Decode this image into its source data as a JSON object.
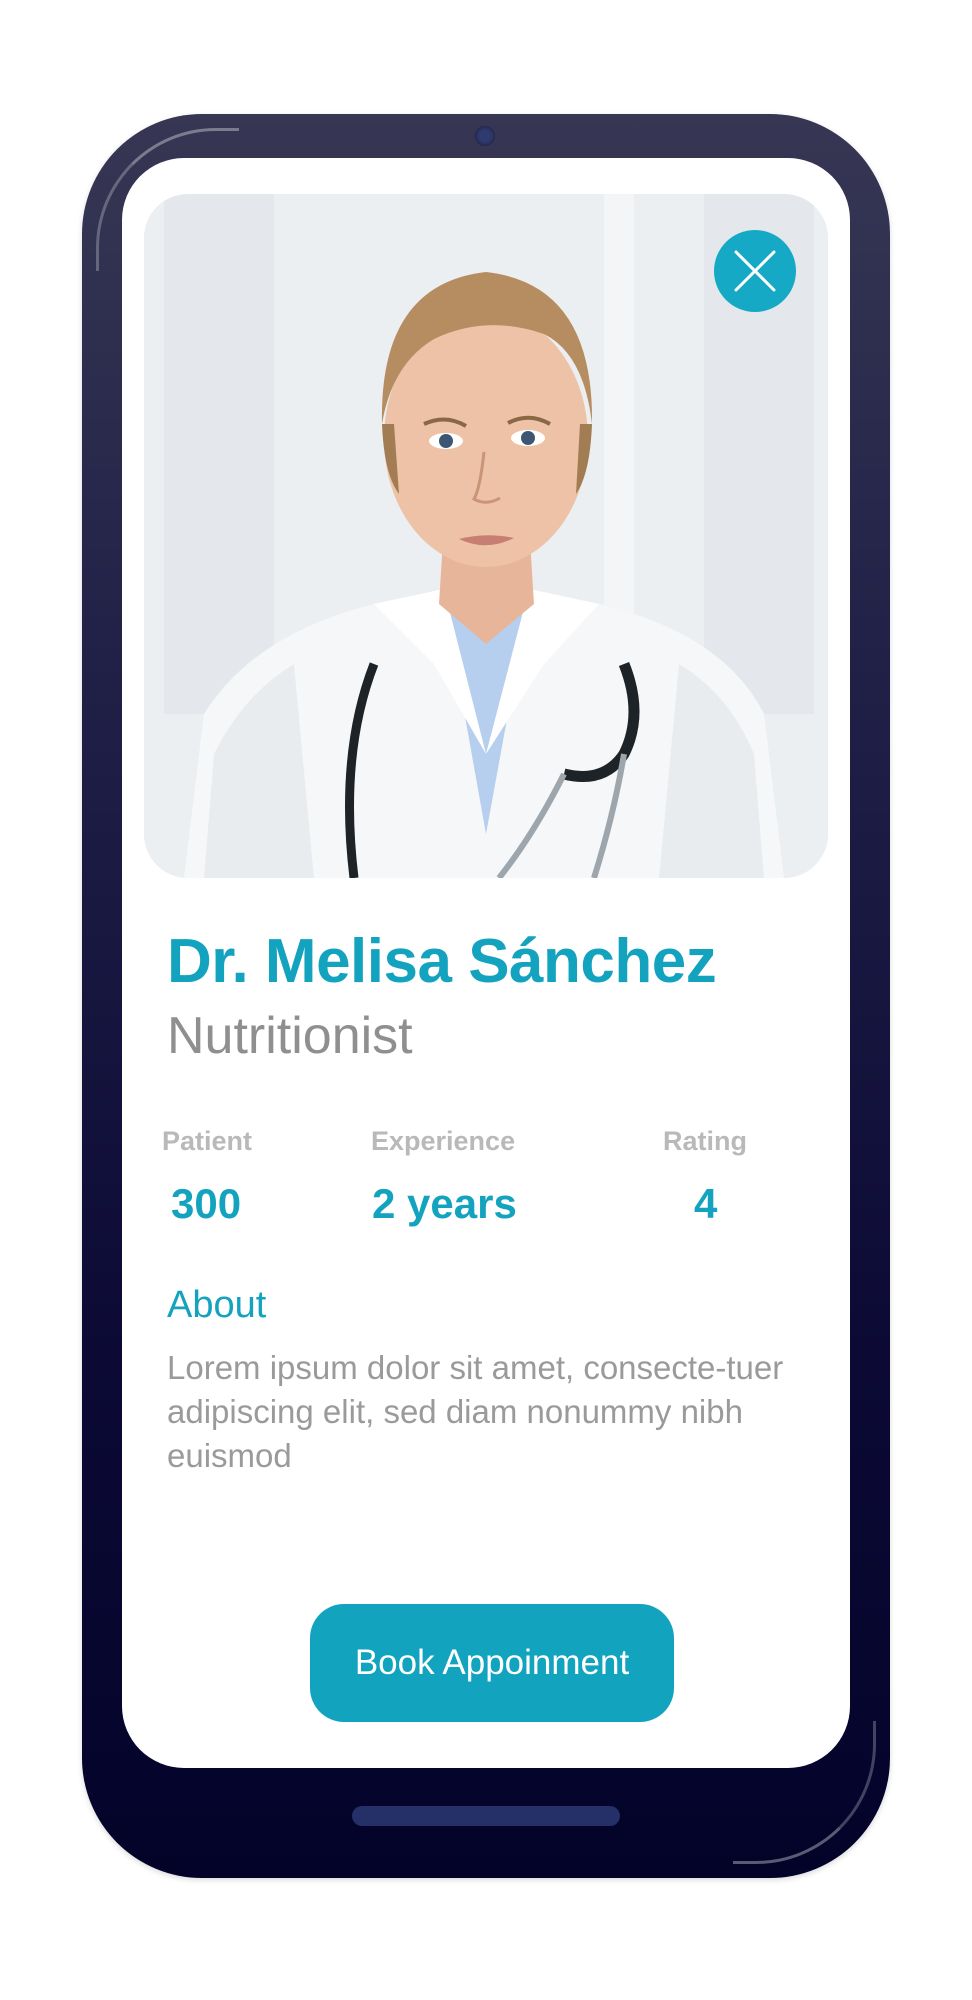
{
  "doctor": {
    "name": "Dr. Melisa Sánchez",
    "specialty": "Nutritionist"
  },
  "stats": {
    "patient": {
      "label": "Patient",
      "value": "300"
    },
    "experience": {
      "label": "Experience",
      "value": "2 years"
    },
    "rating": {
      "label": "Rating",
      "value": "4"
    }
  },
  "about": {
    "title": "About",
    "text": "Lorem ipsum dolor sit amet, consecte-tuer adipiscing elit, sed diam nonummy nibh euismod"
  },
  "actions": {
    "book_label": "Book Appoinment",
    "close_icon": "close-icon"
  },
  "colors": {
    "accent": "#14a3bf",
    "phone_body": "#0c0a35",
    "label_gray": "#b9b9b9",
    "text_gray": "#9a9a9a"
  }
}
